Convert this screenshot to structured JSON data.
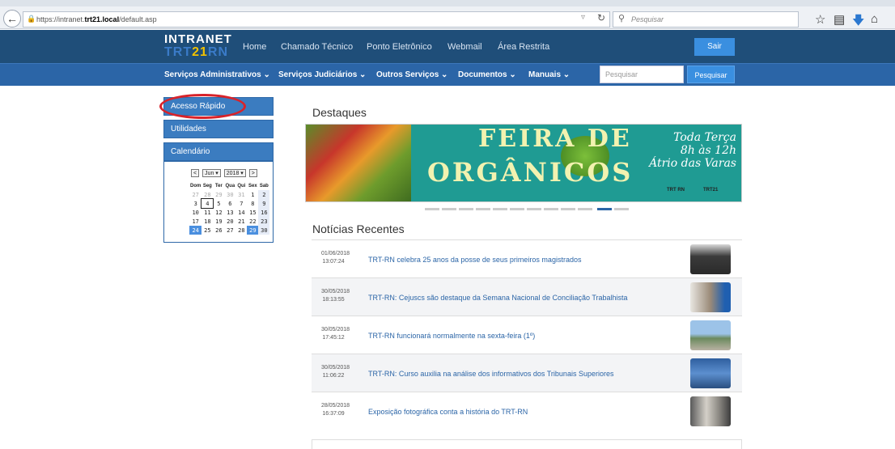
{
  "browser": {
    "url_prefix": "https://intranet.",
    "url_host": "trt21.local",
    "url_path": "/default.asp",
    "search_placeholder": "Pesquisar"
  },
  "header": {
    "logo_top": "INTRANET",
    "logo_prefix": "TRT",
    "logo_number": "21",
    "logo_suffix": "RN",
    "nav": [
      "Home",
      "Chamado Técnico",
      "Ponto Eletrônico",
      "Webmail",
      "Área Restrita"
    ],
    "logout": "Sair"
  },
  "menu": {
    "items": [
      "Serviços Administrativos ⌄",
      "Serviços Judiciários ⌄",
      "Outros Serviços ⌄",
      "Documentos ⌄",
      "Manuais ⌄"
    ],
    "search_placeholder": "Pesquisar",
    "search_button": "Pesquisar"
  },
  "sidebar": {
    "panels": [
      "Acesso Rápido",
      "Utilidades",
      "Calendário"
    ],
    "calendar": {
      "month": "Jun",
      "year": "2018",
      "weekdays": [
        "Dom",
        "Seg",
        "Ter",
        "Qua",
        "Qui",
        "Sex",
        "Sab"
      ],
      "weeks": [
        [
          "27",
          "28",
          "29",
          "30",
          "31",
          "1",
          "2"
        ],
        [
          "3",
          "4",
          "5",
          "6",
          "7",
          "8",
          "9"
        ],
        [
          "10",
          "11",
          "12",
          "13",
          "14",
          "15",
          "16"
        ],
        [
          "17",
          "18",
          "19",
          "20",
          "21",
          "22",
          "23"
        ],
        [
          "24",
          "25",
          "26",
          "27",
          "28",
          "29",
          "30"
        ]
      ]
    }
  },
  "main": {
    "highlights_title": "Destaques",
    "banner": {
      "line1": "FEIRA DE",
      "line2": "ORGÂNICOS",
      "right_lines": [
        "Toda Terça",
        "8h às 12h",
        "Átrio das Varas"
      ],
      "logo_left": "TRT RN",
      "logo_right": "TRT21"
    },
    "news_title": "Notícias Recentes",
    "news": [
      {
        "date": "01/06/2018",
        "time": "13:07:24",
        "title": "TRT-RN celebra 25 anos da posse de seus primeiros magistrados"
      },
      {
        "date": "30/05/2018",
        "time": "18:13:55",
        "title": "TRT-RN: Cejuscs são destaque da Semana Nacional de Conciliação Trabalhista"
      },
      {
        "date": "30/05/2018",
        "time": "17:45:12",
        "title": "TRT-RN funcionará normalmente na sexta-feira (1º)"
      },
      {
        "date": "30/05/2018",
        "time": "11:06:22",
        "title": "TRT-RN: Curso auxilia na análise dos informativos dos Tribunais Superiores"
      },
      {
        "date": "28/05/2018",
        "time": "16:37:09",
        "title": "Exposição fotográfica conta a história do TRT-RN"
      }
    ]
  }
}
